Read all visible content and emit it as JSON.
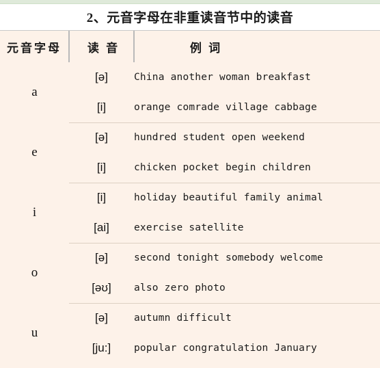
{
  "title": "2、元音字母在非重读音节中的读音",
  "table": {
    "headers": {
      "vowel_letter": "元音字母",
      "pronunciation": "读 音",
      "examples": "例 词"
    },
    "groups": [
      {
        "letter": "a",
        "rows": [
          {
            "sound": "[ə]",
            "examples": "China another woman breakfast"
          },
          {
            "sound": "[i]",
            "examples": "orange comrade village cabbage"
          }
        ]
      },
      {
        "letter": "e",
        "rows": [
          {
            "sound": "[ə]",
            "examples": "hundred student open weekend"
          },
          {
            "sound": "[i]",
            "examples": "chicken pocket begin children"
          }
        ]
      },
      {
        "letter": "i",
        "rows": [
          {
            "sound": "[i]",
            "examples": "holiday beautiful family animal"
          },
          {
            "sound": "[ai]",
            "examples": "exercise satellite"
          }
        ]
      },
      {
        "letter": "o",
        "rows": [
          {
            "sound": "[ə]",
            "examples": "second tonight somebody welcome"
          },
          {
            "sound": "[əʊ]",
            "examples": "also zero photo"
          }
        ]
      },
      {
        "letter": "u",
        "rows": [
          {
            "sound": "[ə]",
            "examples": "autumn difficult"
          },
          {
            "sound": "[ju:]",
            "examples": "popular congratulation January"
          }
        ]
      }
    ]
  },
  "colors": {
    "table_background": "#fdf2e9",
    "top_band": "#dfeada",
    "divider": "#b9b9b9",
    "text": "#1a1a1a"
  }
}
